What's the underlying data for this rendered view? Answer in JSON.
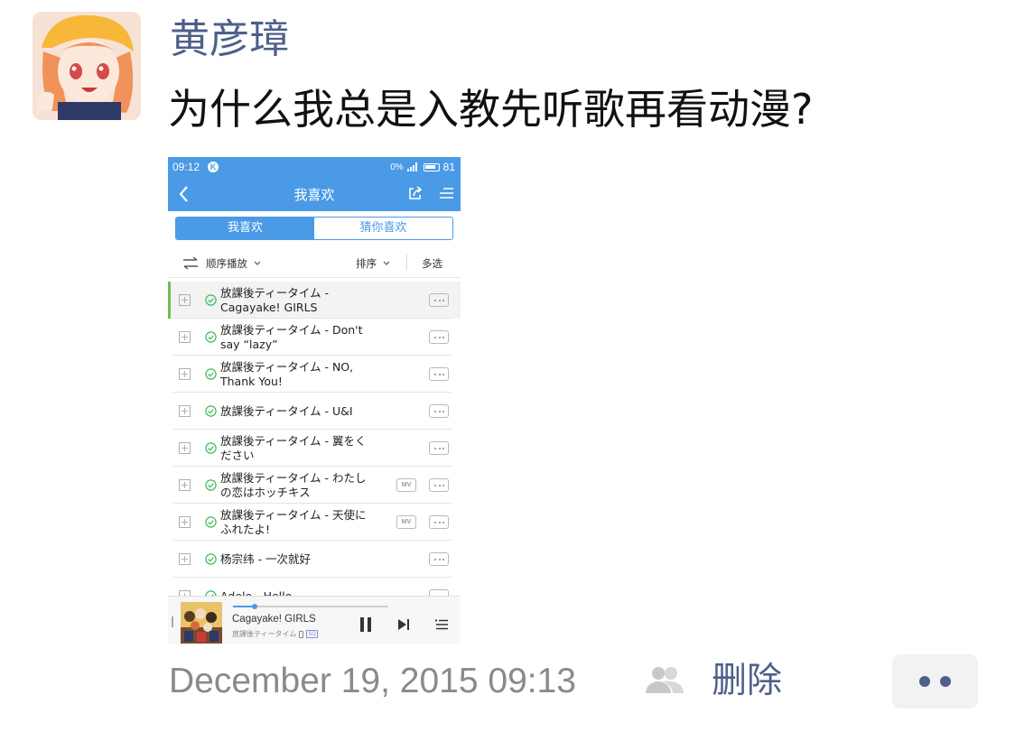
{
  "post": {
    "username": "黄彦璋",
    "text": "为什么我总是入教先听歌再看动漫?",
    "date": "December 19, 2015 09:13",
    "delete_label": "删除"
  },
  "colors": {
    "link": "#4d5f8a",
    "app_accent": "#4a9ae6",
    "now_playing_bar": "#6cc04a",
    "check_icon": "#3dbb5a"
  },
  "phone": {
    "status_bar": {
      "time": "09:12",
      "k_badge": "K",
      "data": "0%",
      "battery": "81"
    },
    "nav": {
      "title": "我喜欢",
      "back_icon": "chevron-left-icon",
      "share_icon": "share-icon",
      "menu_icon": "menu-icon"
    },
    "tabs": [
      {
        "label": "我喜欢",
        "active": true
      },
      {
        "label": "猜你喜欢",
        "active": false
      }
    ],
    "toolbar": {
      "play_order": "顺序播放",
      "sort": "排序",
      "multi_select": "多选"
    },
    "songs": [
      {
        "line1": "放課後ティータイム -",
        "line2": "Cagayake! GIRLS",
        "mv": "",
        "current": true
      },
      {
        "line1": "放課後ティータイム - Don't",
        "line2": "say “lazy”",
        "mv": "",
        "current": false
      },
      {
        "line1": "放課後ティータイム - NO,",
        "line2": "Thank You!",
        "mv": "",
        "current": false
      },
      {
        "line1": "放課後ティータイム - U&I",
        "line2": "",
        "mv": "",
        "current": false
      },
      {
        "line1": "放課後ティータイム - 翼をく",
        "line2": "ださい",
        "mv": "",
        "current": false
      },
      {
        "line1": "放課後ティータイム - わたし",
        "line2": "の恋はホッチキス",
        "mv": "MV",
        "current": false
      },
      {
        "line1": "放課後ティータイム - 天使に",
        "line2": "ふれたよ!",
        "mv": "MV",
        "current": false
      },
      {
        "line1": "杨宗纬 - 一次就好",
        "line2": "",
        "mv": "",
        "current": false
      },
      {
        "line1": "Adele - Hello",
        "line2": "",
        "mv": "",
        "current": false
      }
    ],
    "player": {
      "track": "Cagayake! GIRLS",
      "artist": "放課後ティータイム",
      "quality_badge": "SQ",
      "progress": 0.14
    }
  }
}
